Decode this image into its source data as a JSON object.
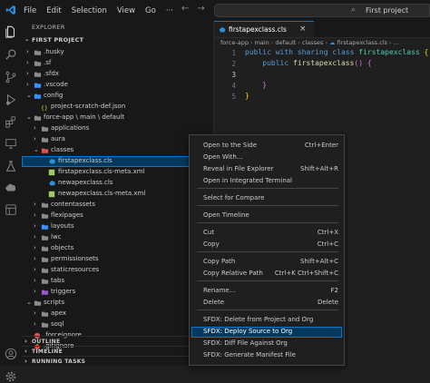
{
  "titlebar": {
    "menu": [
      "File",
      "Edit",
      "Selection",
      "View",
      "Go"
    ],
    "more": "···",
    "nav_back": "←",
    "nav_forward": "→",
    "search_text": "First project"
  },
  "activity_bar": {
    "icons": [
      "files-icon",
      "search-icon",
      "source-control-icon",
      "run-debug-icon",
      "extensions-icon",
      "remote-explorer-icon",
      "testing-icon",
      "salesforce-icon",
      "org-browser-icon",
      "accounts-icon",
      "settings-gear-icon"
    ]
  },
  "sidebar": {
    "title": "EXPLORER",
    "project": "FIRST PROJECT",
    "tree": [
      {
        "label": ".husky",
        "icon": "folder"
      },
      {
        "label": ".sf",
        "icon": "folder"
      },
      {
        "label": ".sfdx",
        "icon": "folder"
      },
      {
        "label": ".vscode",
        "icon": "folder-blue"
      },
      {
        "label": "config",
        "icon": "folder-blue"
      },
      {
        "label": "project-scratch-def.json",
        "icon": "json"
      },
      {
        "label": "force-app \\ main \\ default",
        "icon": "folder"
      },
      {
        "label": "applications",
        "icon": "folder"
      },
      {
        "label": "aura",
        "icon": "folder"
      },
      {
        "label": "classes",
        "icon": "folder-red"
      },
      {
        "label": "firstapexclass.cls",
        "icon": "apex"
      },
      {
        "label": "firstapexclass.cls-meta.xml",
        "icon": "xml"
      },
      {
        "label": "newapexclass.cls",
        "icon": "apex"
      },
      {
        "label": "newapexclass.cls-meta.xml",
        "icon": "xml"
      },
      {
        "label": "contentassets",
        "icon": "folder"
      },
      {
        "label": "flexipages",
        "icon": "folder"
      },
      {
        "label": "layouts",
        "icon": "folder-blue"
      },
      {
        "label": "lwc",
        "icon": "folder"
      },
      {
        "label": "objects",
        "icon": "folder"
      },
      {
        "label": "permissionsets",
        "icon": "folder"
      },
      {
        "label": "staticresources",
        "icon": "folder"
      },
      {
        "label": "tabs",
        "icon": "folder"
      },
      {
        "label": "triggers",
        "icon": "folder-purple"
      },
      {
        "label": "scripts",
        "icon": "folder"
      },
      {
        "label": "apex",
        "icon": "folder"
      },
      {
        "label": "soql",
        "icon": "folder"
      },
      {
        "label": ".forceignore",
        "icon": "forceignore"
      },
      {
        "label": ".gitignore",
        "icon": "gitignore"
      }
    ],
    "sections": [
      "OUTLINE",
      "TIMELINE",
      "RUNNING TASKS"
    ]
  },
  "editor": {
    "tab_label": "firstapexclass.cls",
    "tab_close": "×",
    "breadcrumbs": [
      "force-app",
      "main",
      "default",
      "classes",
      "firstapexclass.cls",
      "..."
    ],
    "line_numbers": [
      "1",
      "2",
      "3",
      "4",
      "5"
    ],
    "code": {
      "l1_kw1": "public",
      "l1_kw2": "with sharing",
      "l1_kw3": "class",
      "l1_cls": "firstapexclass",
      "l1_brace": "{",
      "l2_kw": "public",
      "l2_fn": "firstapexclass",
      "l2_paren": "()",
      "l2_brace": "{",
      "l4_brace": "}",
      "l5_brace": "}"
    }
  },
  "context_menu": {
    "items": [
      {
        "label": "Open to the Side",
        "shortcut": "Ctrl+Enter"
      },
      {
        "label": "Open With...",
        "shortcut": ""
      },
      {
        "label": "Reveal in File Explorer",
        "shortcut": "Shift+Alt+R"
      },
      {
        "label": "Open in Integrated Terminal",
        "shortcut": ""
      },
      {
        "label": "Select for Compare",
        "shortcut": ""
      },
      {
        "label": "Open Timeline",
        "shortcut": ""
      },
      {
        "label": "Cut",
        "shortcut": "Ctrl+X"
      },
      {
        "label": "Copy",
        "shortcut": "Ctrl+C"
      },
      {
        "label": "Copy Path",
        "shortcut": "Shift+Alt+C"
      },
      {
        "label": "Copy Relative Path",
        "shortcut": "Ctrl+K Ctrl+Shift+C"
      },
      {
        "label": "Rename...",
        "shortcut": "F2"
      },
      {
        "label": "Delete",
        "shortcut": "Delete"
      },
      {
        "label": "SFDX: Delete from Project and Org",
        "shortcut": ""
      },
      {
        "label": "SFDX: Deploy Source to Org",
        "shortcut": ""
      },
      {
        "label": "SFDX: Diff File Against Org",
        "shortcut": ""
      },
      {
        "label": "SFDX: Generate Manifest File",
        "shortcut": ""
      }
    ],
    "highlighted_index": 13
  },
  "colors": {
    "accent": "#0078d4",
    "selection": "#04395e",
    "folder": "#8b8b8b",
    "folder_blue": "#3794ff",
    "folder_red": "#e05252",
    "apex": "#2f8fd8",
    "xml": "#9ccc65"
  }
}
